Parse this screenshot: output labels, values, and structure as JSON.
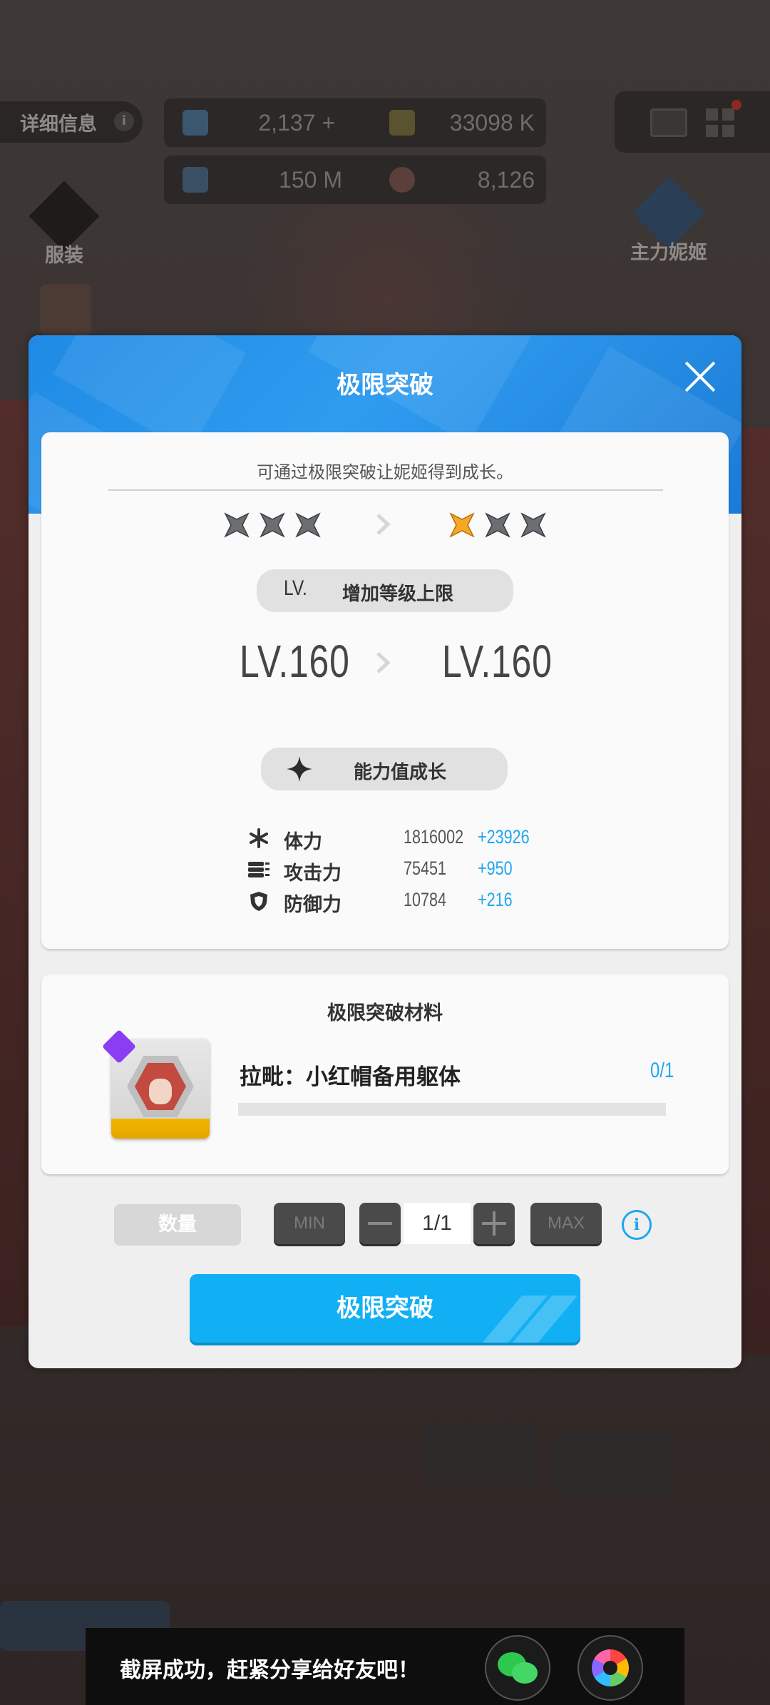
{
  "hud": {
    "detail_label": "详细信息",
    "info_glyph": "i",
    "resources": [
      {
        "icon": "gem-icon",
        "value": "2,137 +"
      },
      {
        "icon": "credit-card-icon",
        "value": "33098 K"
      },
      {
        "icon": "battle-data-icon",
        "value": "150 M"
      },
      {
        "icon": "core-dust-icon",
        "value": "8,126"
      }
    ],
    "costume_label": "服装",
    "main_nikke_label": "主力妮姬"
  },
  "modal": {
    "title": "极限突破",
    "description": "可通过极限突破让妮姬得到成长。",
    "stars_before": [
      false,
      false,
      false
    ],
    "stars_after": [
      true,
      false,
      false
    ],
    "level_section": {
      "lv_tag": "LV.",
      "label": "增加等级上限",
      "from": "LV.160",
      "to": "LV.160"
    },
    "stat_section_label": "能力值成长",
    "stats": [
      {
        "icon": "hp-asterisk-icon",
        "name": "体力",
        "value": "1816002",
        "bonus": "+23926"
      },
      {
        "icon": "attack-bullets-icon",
        "name": "攻击力",
        "value": "75451",
        "bonus": "+950"
      },
      {
        "icon": "defense-shield-icon",
        "name": "防御力",
        "value": "10784",
        "bonus": "+216"
      }
    ],
    "materials": {
      "title": "极限突破材料",
      "item_name": "拉毗：小红帽备用躯体",
      "count": "0/1",
      "progress": 0
    },
    "quantity": {
      "label": "数量",
      "min_label": "MIN",
      "max_label": "MAX",
      "value": "1/1",
      "info_glyph": "i"
    },
    "confirm_label": "极限突破"
  },
  "toast": {
    "message": "截屏成功，赶紧分享给好友吧！"
  },
  "colors": {
    "accent_blue": "#1ea7f0",
    "button_blue": "#11b0f4",
    "header_blue": "#1f8ae4",
    "star_active": "#f4a823",
    "star_inactive": "#6b6e72"
  }
}
